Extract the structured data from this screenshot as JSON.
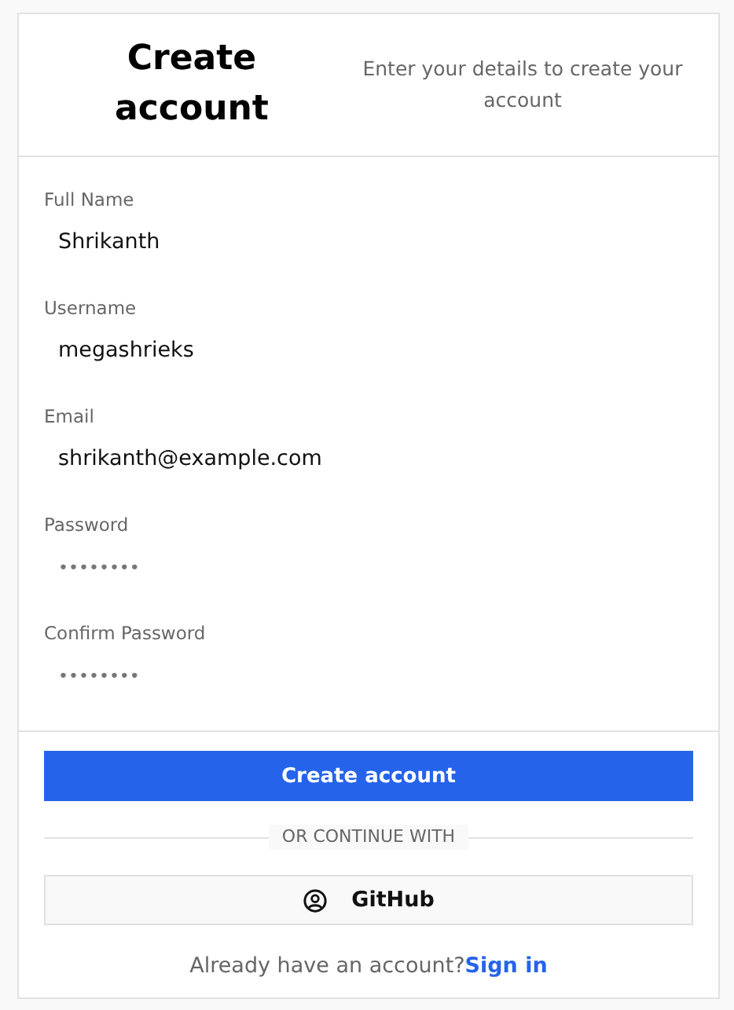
{
  "header": {
    "title": "Create account",
    "subtitle": "Enter your details to create your account"
  },
  "fields": [
    {
      "label": "Full Name",
      "value": "Shrikanth",
      "kind": "text"
    },
    {
      "label": "Username",
      "value": "megashrieks",
      "kind": "text"
    },
    {
      "label": "Email",
      "value": "shrikanth@example.com",
      "kind": "text"
    },
    {
      "label": "Password",
      "value": "••••••••",
      "kind": "password"
    },
    {
      "label": "Confirm Password",
      "value": "••••••••",
      "kind": "password"
    }
  ],
  "submit": "Create account",
  "divider": "OR CONTINUE WITH",
  "oauth": {
    "label": "GitHub"
  },
  "footer": {
    "text": "Already have an account?",
    "link": "Sign in"
  }
}
